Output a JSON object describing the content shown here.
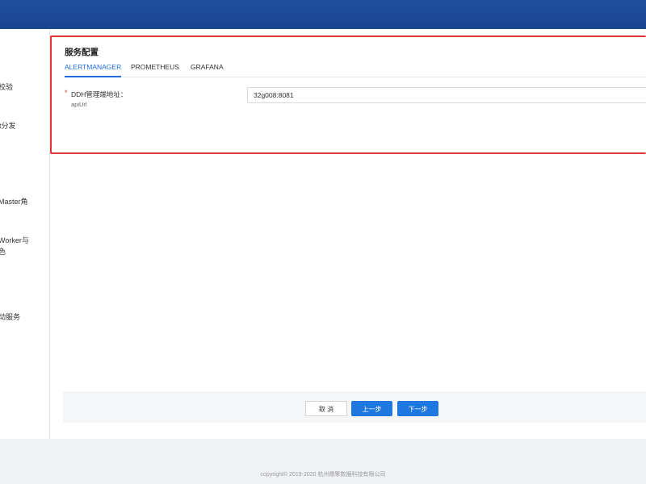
{
  "sidebar": {
    "items": [
      {
        "label": "校验"
      },
      {
        "label": "nt分发"
      },
      {
        "label": "Master角"
      },
      {
        "label": "Worker与"
      },
      {
        "label": "色"
      },
      {
        "label": "动服务"
      }
    ]
  },
  "panel": {
    "title": "服务配置",
    "tabs": [
      {
        "label": "ALERTMANAGER"
      },
      {
        "label": "PROMETHEUS"
      },
      {
        "label": "GRAFANA"
      }
    ],
    "active_tab": "ALERTMANAGER",
    "field": {
      "required_mark": "*",
      "label": "DDH管理端地址：",
      "sublabel": "apiUrl",
      "value": "32g008:8081"
    }
  },
  "footer": {
    "cancel_label": "取 消",
    "prev_label": "上一步",
    "next_label": "下一步"
  },
  "copyright": "copyright© 2019-2020 杭州鼎擎数据科技有限公司",
  "colors": {
    "topbar": "#1f4f9e",
    "accent": "#1f78e0",
    "highlight_border": "#e0363a"
  }
}
